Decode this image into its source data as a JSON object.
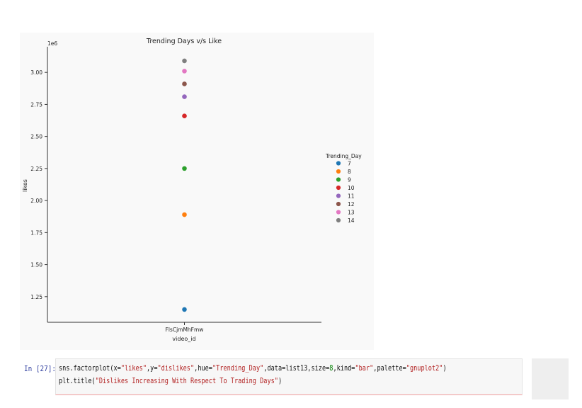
{
  "chart_data": {
    "type": "scatter",
    "title": "Trending Days v/s Like",
    "xlabel": "video_id",
    "ylabel": "likes",
    "y_scale_label": "1e6",
    "categories": [
      "FlsCjmMhFmw"
    ],
    "ylim": [
      1.05,
      3.2
    ],
    "yticks": [
      1.25,
      1.5,
      1.75,
      2.0,
      2.25,
      2.5,
      2.75,
      3.0
    ],
    "ytick_labels": [
      "1.25",
      "1.50",
      "1.75",
      "2.00",
      "2.25",
      "2.50",
      "2.75",
      "3.00"
    ],
    "legend_title": "Trending_Day",
    "legend_position": "right",
    "series": [
      {
        "name": "7",
        "color": "#1f77b4",
        "values": [
          1.15
        ]
      },
      {
        "name": "8",
        "color": "#ff7f0e",
        "values": [
          1.89
        ]
      },
      {
        "name": "9",
        "color": "#2ca02c",
        "values": [
          2.25
        ]
      },
      {
        "name": "10",
        "color": "#d62728",
        "values": [
          2.66
        ]
      },
      {
        "name": "11",
        "color": "#9467bd",
        "values": [
          2.81
        ]
      },
      {
        "name": "12",
        "color": "#8c564b",
        "values": [
          2.91
        ]
      },
      {
        "name": "13",
        "color": "#e377c2",
        "values": [
          3.01
        ]
      },
      {
        "name": "14",
        "color": "#7f7f7f",
        "values": [
          3.09
        ]
      }
    ]
  },
  "cell": {
    "prompt": "In [27]:",
    "line1": [
      {
        "t": "sns.factorplot(x=",
        "c": ""
      },
      {
        "t": "\"likes\"",
        "c": "str"
      },
      {
        "t": ",y=",
        "c": ""
      },
      {
        "t": "\"dislikes\"",
        "c": "str"
      },
      {
        "t": ",hue=",
        "c": ""
      },
      {
        "t": "\"Trending_Day\"",
        "c": "str"
      },
      {
        "t": ",data=list13,size=",
        "c": ""
      },
      {
        "t": "8",
        "c": "num"
      },
      {
        "t": ",kind=",
        "c": ""
      },
      {
        "t": "\"bar\"",
        "c": "str"
      },
      {
        "t": ",palette=",
        "c": ""
      },
      {
        "t": "\"gnuplot2\"",
        "c": "str"
      },
      {
        "t": ")",
        "c": ""
      }
    ],
    "line2": [
      {
        "t": "plt.title(",
        "c": ""
      },
      {
        "t": "\"Dislikes Increasing With Respect To Trading Days\"",
        "c": "str"
      },
      {
        "t": ")",
        "c": ""
      }
    ]
  }
}
